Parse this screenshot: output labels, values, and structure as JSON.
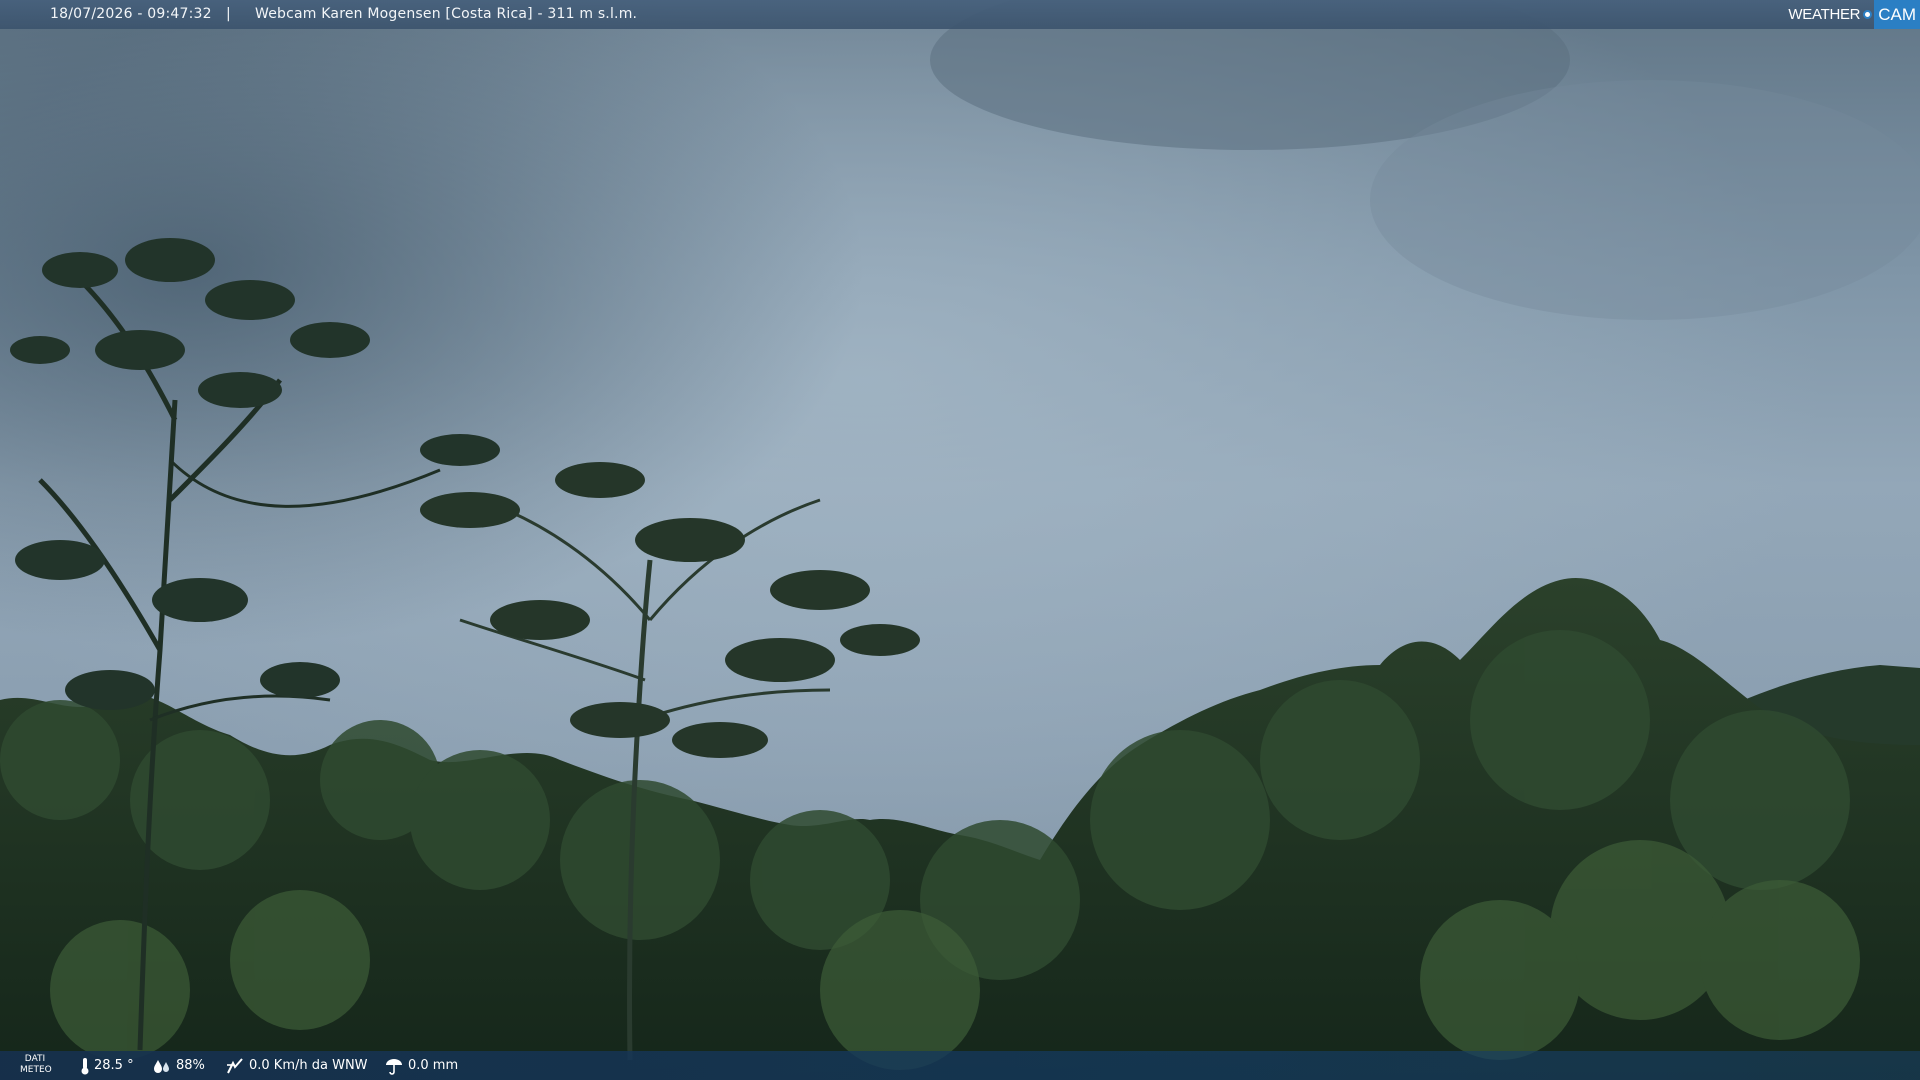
{
  "header": {
    "timestamp": "18/07/2026 - 09:47:32",
    "separator": "|",
    "title": "Webcam Karen Mogensen [Costa Rica] - 311 m s.l.m."
  },
  "logo": {
    "left_text": "WEATHER",
    "right_text": "CAM",
    "accent_color": "#2b7fc4"
  },
  "weather_bar": {
    "label_line1": "DATI",
    "label_line2": "METEO",
    "temperature": "28.5 °",
    "humidity": "88%",
    "wind": "0.0 Km/h da WNW",
    "rain": "0.0 mm",
    "icons": [
      "thermometer-icon",
      "humidity-icon",
      "wind-icon",
      "rain-icon"
    ]
  },
  "scene": {
    "description_colors": {
      "sky_top": "#6f8394",
      "sky_mid": "#98acbd",
      "forest": "#1f3320"
    }
  }
}
